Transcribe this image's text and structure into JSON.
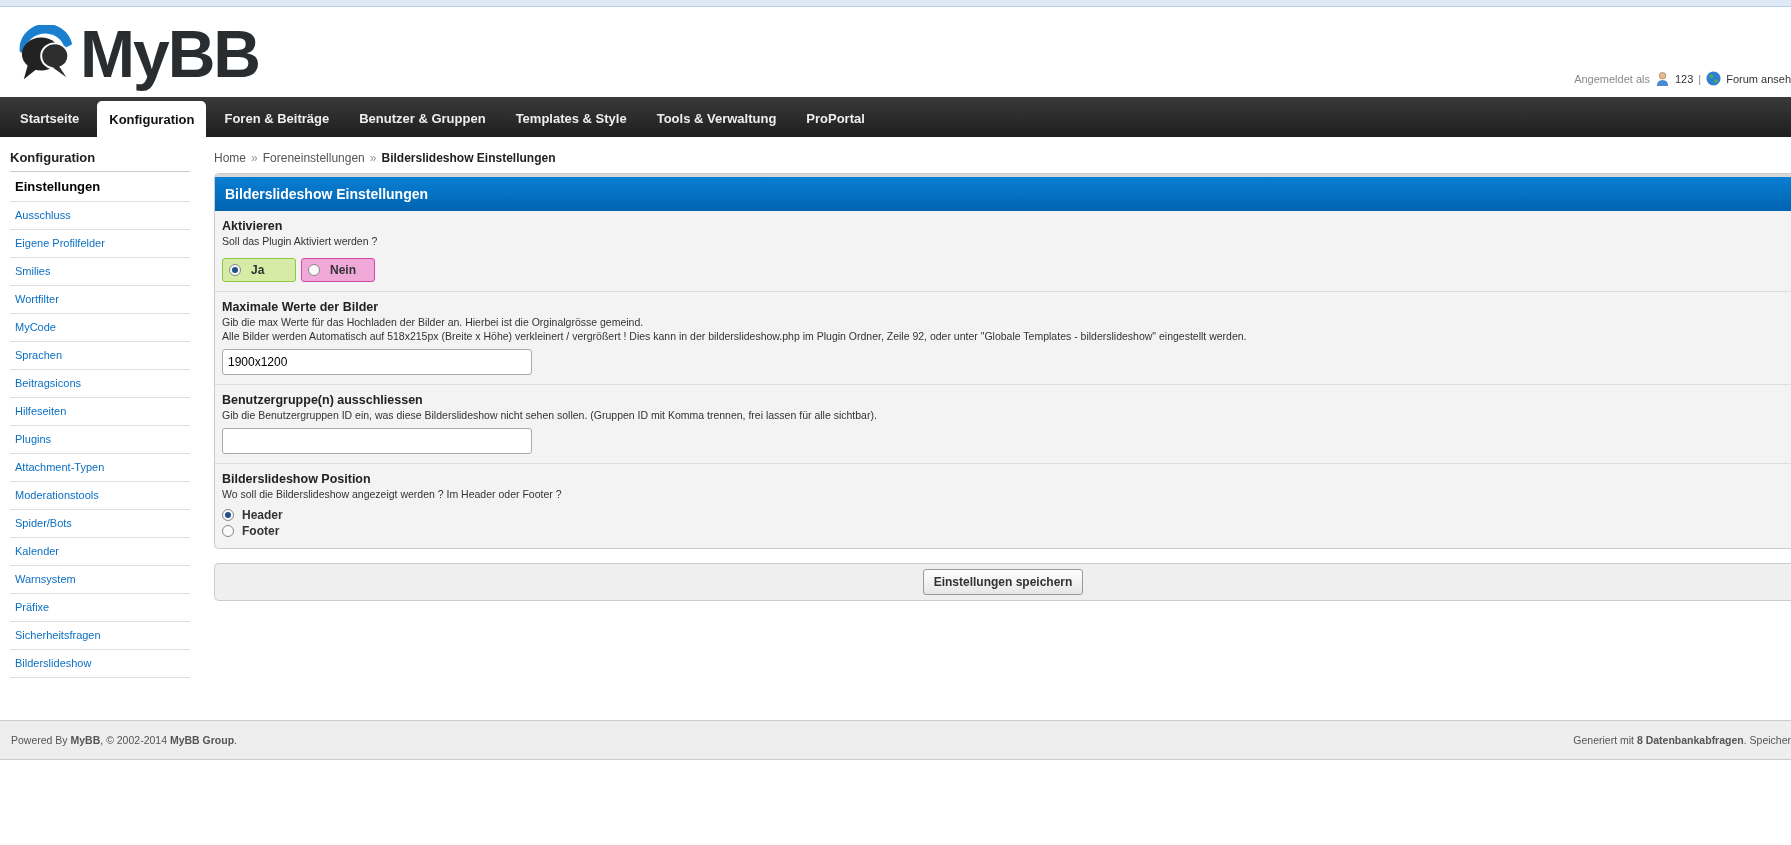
{
  "header": {
    "logo": "MyBB",
    "logged_in_label": "Angemeldet als",
    "user": "123",
    "separator": "|",
    "forum_link": "Forum anseh"
  },
  "tabs": [
    {
      "label": "Startseite",
      "selected": false
    },
    {
      "label": "Konfiguration",
      "selected": true
    },
    {
      "label": "Foren & Beiträge",
      "selected": false
    },
    {
      "label": "Benutzer & Gruppen",
      "selected": false
    },
    {
      "label": "Templates & Style",
      "selected": false
    },
    {
      "label": "Tools & Verwaltung",
      "selected": false
    },
    {
      "label": "ProPortal",
      "selected": false
    }
  ],
  "sidebar": {
    "title": "Konfiguration",
    "items": [
      {
        "label": "Einstellungen",
        "selected": true
      },
      {
        "label": "Ausschluss",
        "selected": false
      },
      {
        "label": "Eigene Profilfelder",
        "selected": false
      },
      {
        "label": "Smilies",
        "selected": false
      },
      {
        "label": "Wortfilter",
        "selected": false
      },
      {
        "label": "MyCode",
        "selected": false
      },
      {
        "label": "Sprachen",
        "selected": false
      },
      {
        "label": "Beitragsicons",
        "selected": false
      },
      {
        "label": "Hilfeseiten",
        "selected": false
      },
      {
        "label": "Plugins",
        "selected": false
      },
      {
        "label": "Attachment-Typen",
        "selected": false
      },
      {
        "label": "Moderationstools",
        "selected": false
      },
      {
        "label": "Spider/Bots",
        "selected": false
      },
      {
        "label": "Kalender",
        "selected": false
      },
      {
        "label": "Warnsystem",
        "selected": false
      },
      {
        "label": "Präfixe",
        "selected": false
      },
      {
        "label": "Sicherheitsfragen",
        "selected": false
      },
      {
        "label": "Bilderslideshow",
        "selected": false
      }
    ]
  },
  "breadcrumb": [
    {
      "kind": "link",
      "label": "Home"
    },
    {
      "kind": "sep",
      "label": "»"
    },
    {
      "kind": "link",
      "label": "Foreneinstellungen"
    },
    {
      "kind": "sep",
      "label": "»"
    },
    {
      "kind": "current",
      "label": "Bilderslideshow Einstellungen"
    }
  ],
  "panel": {
    "title": "Bilderslideshow Einstellungen",
    "settings": [
      {
        "kind": "pills",
        "title": "Aktivieren",
        "description": [
          "Soll das Plugin Aktiviert werden ?"
        ],
        "options": [
          {
            "label": "Ja",
            "selected": true,
            "color": "#d6eca6"
          },
          {
            "label": "Nein",
            "selected": false,
            "color": "#f0a8d8"
          }
        ]
      },
      {
        "kind": "text",
        "title": "Maximale Werte der Bilder",
        "description": [
          "Gib die max Werte für das Hochladen der Bilder an. Hierbei ist die Orginalgrösse gemeind.",
          "Alle Bilder werden Automatisch auf 518x215px (Breite x Höhe) verkleinert / vergrößert ! Dies kann in der bilderslideshow.php im Plugin Ordner, Zeile 92, oder unter \"Globale Templates - bilderslideshow\" eingestellt werden."
        ],
        "value": "1900x1200"
      },
      {
        "kind": "text",
        "title": "Benutzergruppe(n) ausschliessen",
        "description": [
          "Gib die Benutzergruppen ID ein, was diese Bilderslideshow nicht sehen sollen. (Gruppen ID mit Komma trennen, frei lassen für alle sichtbar)."
        ]
      },
      {
        "kind": "radios",
        "title": "Bilderslideshow Position",
        "description": [
          "Wo soll die Bilderslideshow angezeigt werden ? Im Header oder Footer ?"
        ],
        "options": [
          {
            "label": "Header",
            "selected": true
          },
          {
            "label": "Footer",
            "selected": false
          }
        ]
      }
    ]
  },
  "submit": "Einstellungen speichern",
  "footer": {
    "left": "Powered By **MyBB**, © 2002-2014 **MyBB Group**.",
    "right": "Generiert mit **8 Datenbankabfragen**. Speicher"
  }
}
